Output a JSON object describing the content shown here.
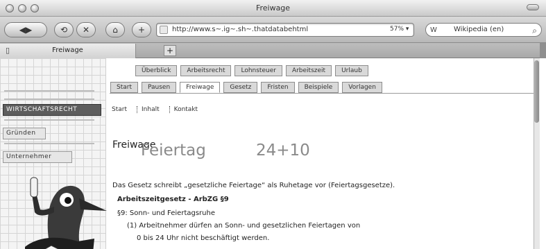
{
  "window": {
    "title": "Freiwage"
  },
  "toolbar": {
    "back_glyph": "◀▶",
    "btn2_glyph": "⟲",
    "btn3_glyph": "✕",
    "home_glyph": "⌂",
    "btn5_glyph": "+",
    "url": "http://www.s~.ig~.sh~.thatdatabehtml",
    "reload_label": "57% ▾",
    "search_placeholder": "Wikipedia (en)",
    "search_prefix": "W"
  },
  "tabs": {
    "active_tab": "Freiwage",
    "new_tab_glyph": "+"
  },
  "sidebar": {
    "nav": [
      {
        "label": "WIRTSCHAFTSRECHT",
        "active": true
      },
      {
        "label": "Gründen",
        "active": false
      },
      {
        "label": "Unternehmer",
        "active": false
      }
    ]
  },
  "content": {
    "top_tabs": [
      "Überblick",
      "Arbeitsrecht",
      "Lohnsteuer",
      "Arbeitszeit",
      "Urlaub"
    ],
    "second_tabs": [
      "Start",
      "Pausen",
      "Freiwage",
      "Gesetz",
      "Fristen",
      "Beispiele",
      "Vorlagen"
    ],
    "active_second_tab": "Freiwage",
    "subnav": [
      "Start",
      "Inhalt",
      "Kontakt"
    ],
    "heading": "Freiwage",
    "holiday_title": "Feiertag",
    "count": "24+10",
    "lines": [
      "Das Gesetz schreibt „gesetzliche Feiertage“ als Ruhetage vor (Feiertagsgesetze).",
      "Arbeitszeitgesetz - ArbZG §9",
      "§9: Sonn- und Feiertagsruhe",
      "(1) Arbeitnehmer dürfen an Sonn- und gesetzlichen Feiertagen von",
      "0 bis 24 Uhr nicht beschäftigt werden."
    ]
  }
}
